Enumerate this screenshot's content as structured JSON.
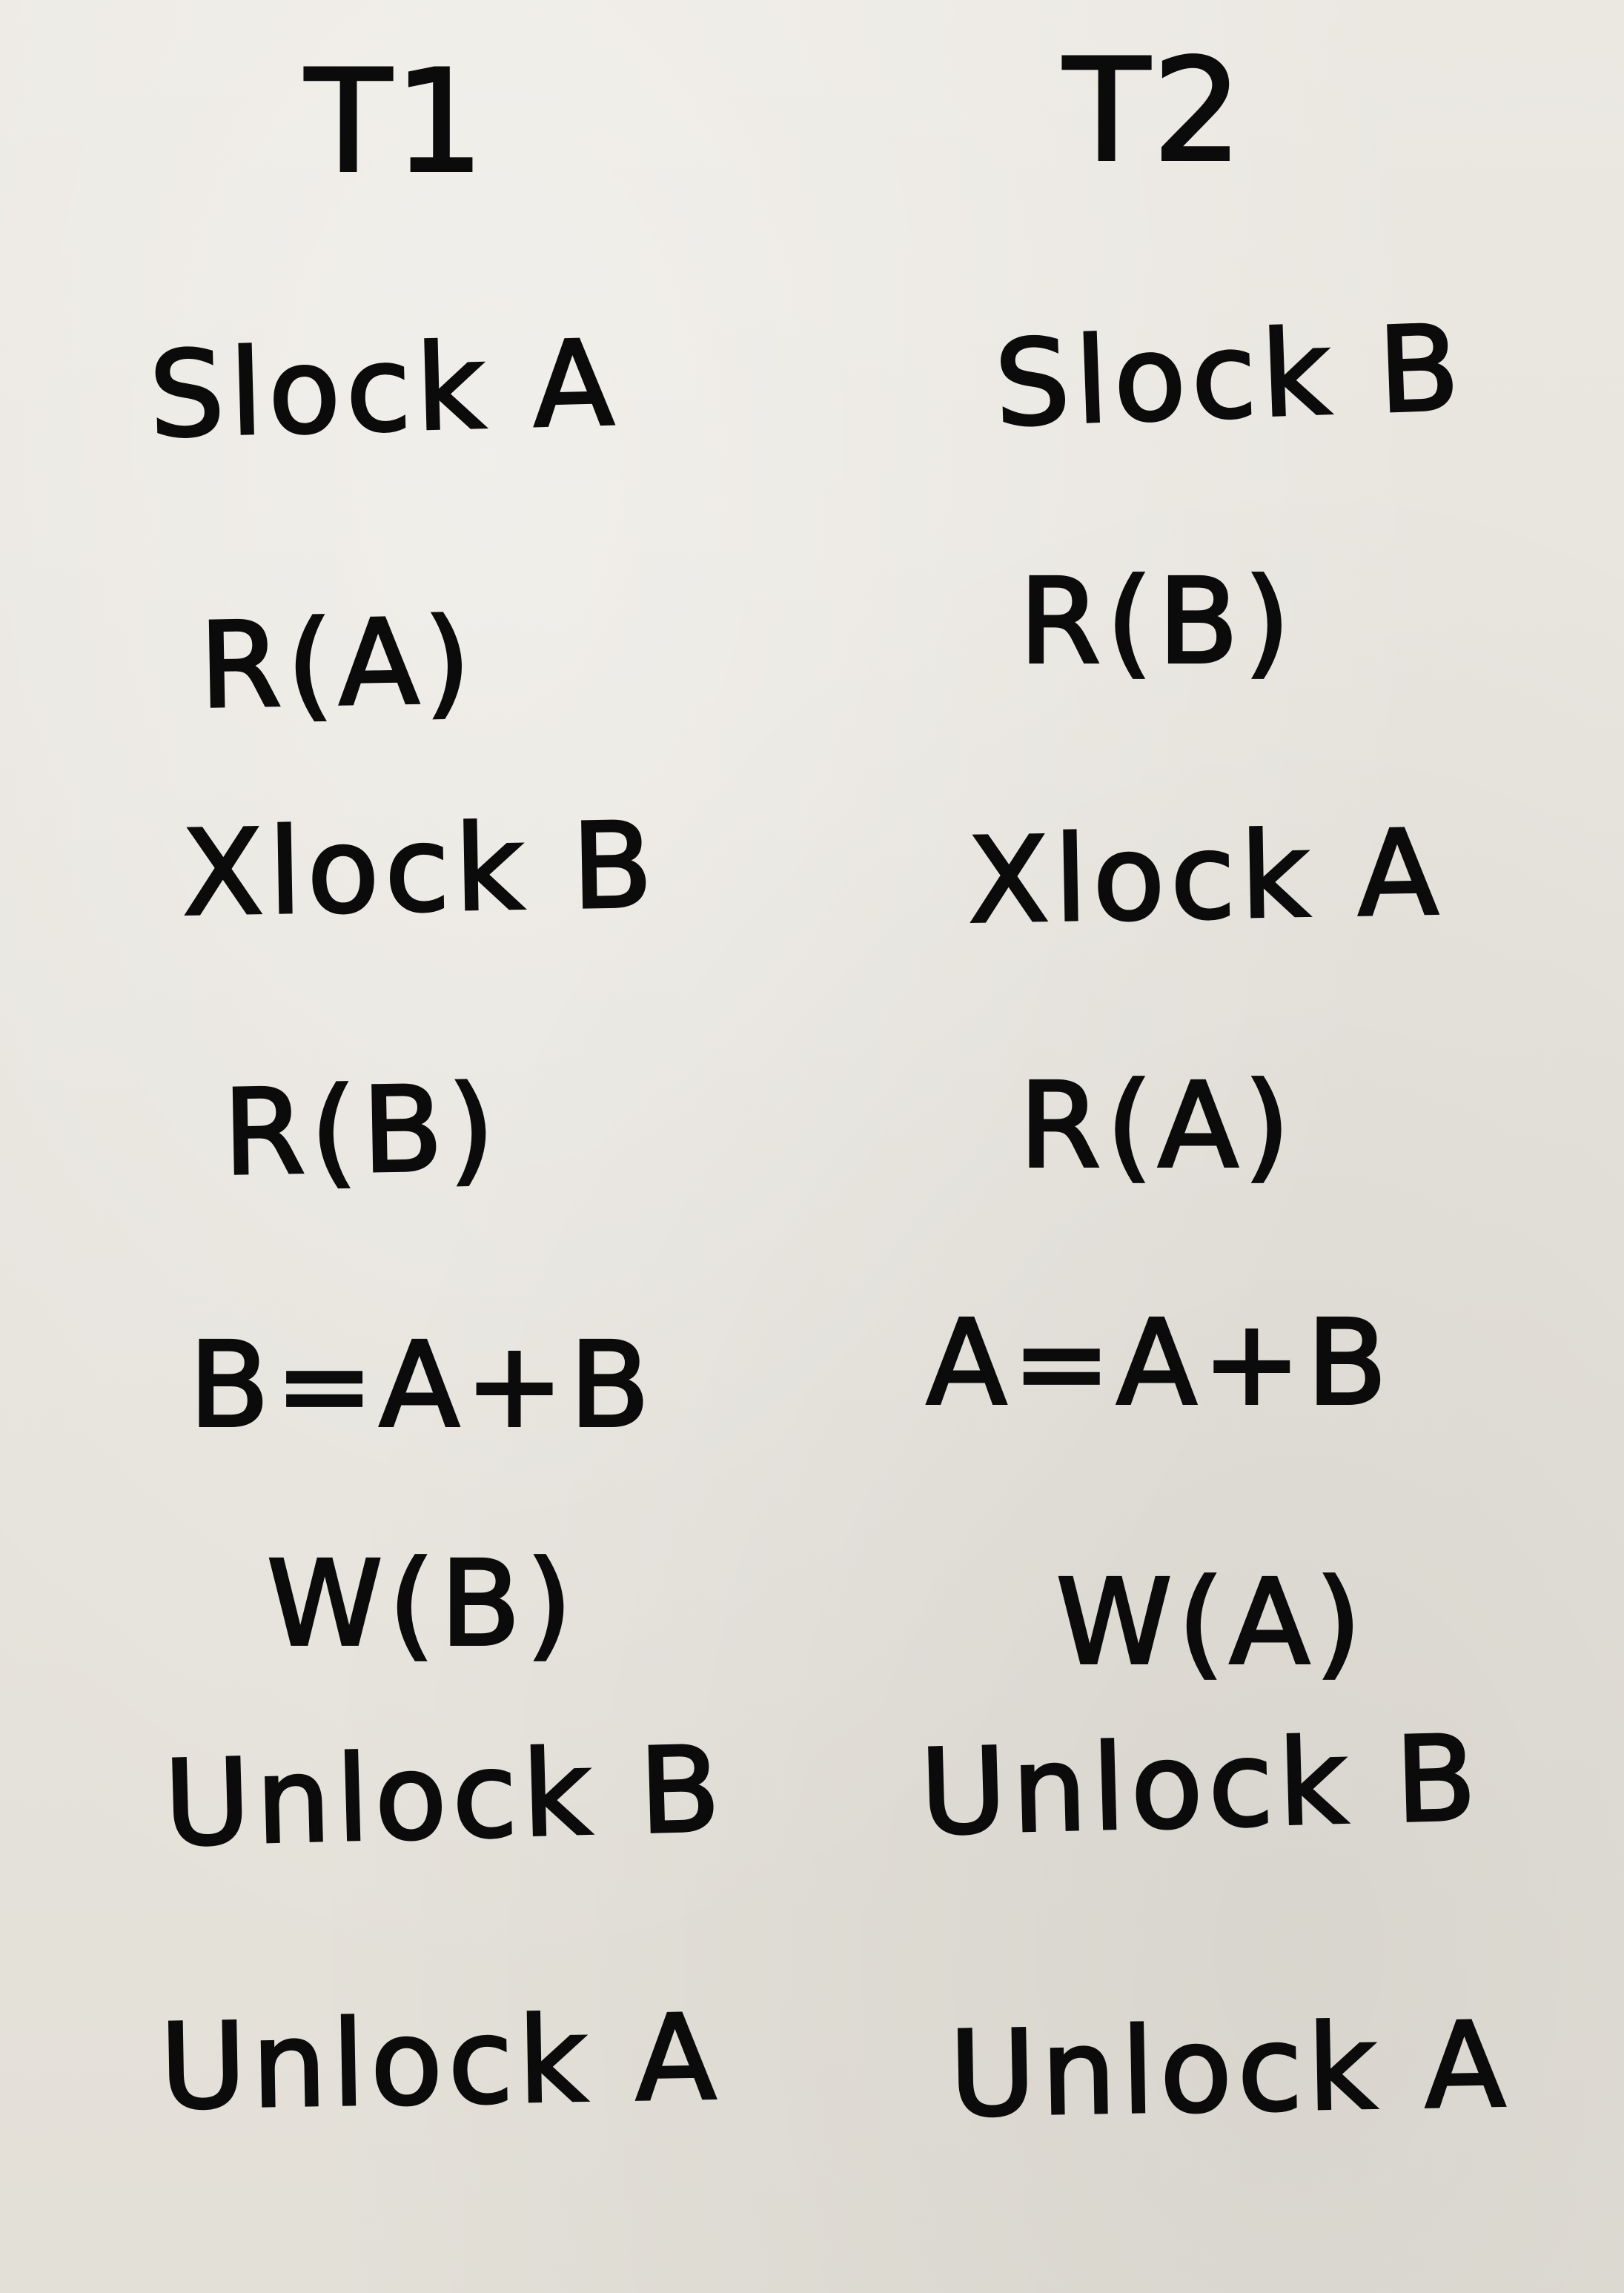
{
  "columns": {
    "t1": {
      "header": "T1",
      "steps": [
        "Slock A",
        "R(A)",
        "Xlock B",
        "R(B)",
        "B=A+B",
        "W(B)",
        "Unlock B",
        "Unlock A"
      ]
    },
    "t2": {
      "header": "T2",
      "steps": [
        "Slock B",
        "R(B)",
        "Xlock A",
        "R(A)",
        "A=A+B",
        "W(A)",
        "Unlock B",
        "Unlock A"
      ]
    }
  }
}
